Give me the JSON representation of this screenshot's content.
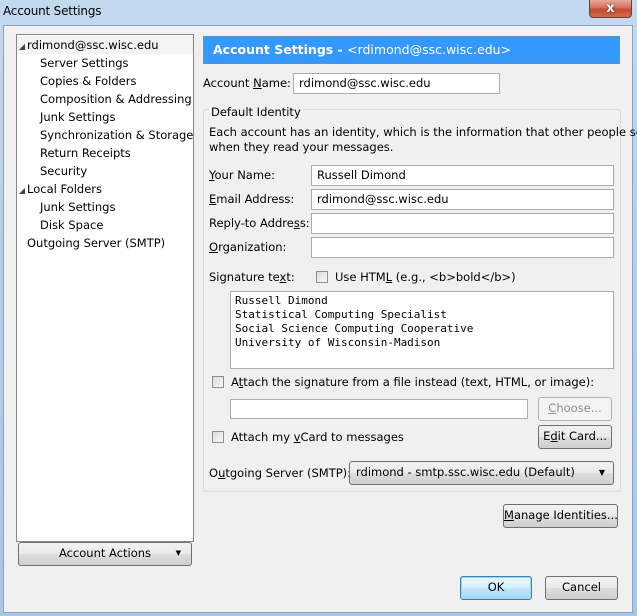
{
  "window": {
    "title": "Account Settings",
    "close_label": "x"
  },
  "tree": {
    "items": [
      {
        "label": "rdimond@ssc.wisc.edu",
        "level": 0,
        "expanded": true,
        "selected": true
      },
      {
        "label": "Server Settings",
        "level": 1
      },
      {
        "label": "Copies & Folders",
        "level": 1
      },
      {
        "label": "Composition & Addressing",
        "level": 1
      },
      {
        "label": "Junk Settings",
        "level": 1
      },
      {
        "label": "Synchronization & Storage",
        "level": 1
      },
      {
        "label": "Return Receipts",
        "level": 1
      },
      {
        "label": "Security",
        "level": 1
      },
      {
        "label": "Local Folders",
        "level": 0,
        "expanded": true
      },
      {
        "label": "Junk Settings",
        "level": 1
      },
      {
        "label": "Disk Space",
        "level": 1
      },
      {
        "label": "Outgoing Server (SMTP)",
        "level": 0
      }
    ],
    "account_actions_label": "Account Actions"
  },
  "header": {
    "title": "Account Settings - ",
    "account": "<rdimond@ssc.wisc.edu>"
  },
  "account_name": {
    "label_pre": "Account ",
    "label_u": "N",
    "label_post": "ame:",
    "value": "rdimond@ssc.wisc.edu"
  },
  "identity": {
    "legend": "Default Identity",
    "description_line1": "Each account has an identity, which is the information that other people see",
    "description_line2": "when they read your messages.",
    "your_name": {
      "label_u": "Y",
      "label_post": "our Name:",
      "value": "Russell Dimond"
    },
    "email": {
      "label_u": "E",
      "label_post": "mail Address:",
      "value": "rdimond@ssc.wisc.edu"
    },
    "reply_to": {
      "label_pre": "Reply-to Addre",
      "label_u": "s",
      "label_post": "s:",
      "value": ""
    },
    "organization": {
      "label_u": "O",
      "label_post": "rganization:",
      "value": ""
    },
    "signature": {
      "label_pre": "Signature te",
      "label_u": "x",
      "label_post": "t:",
      "use_html_pre": "Use HTM",
      "use_html_u": "L",
      "use_html_post": " (e.g., <b>bold</b>)",
      "use_html_checked": false,
      "text": "Russell Dimond\nStatistical Computing Specialist\nSocial Science Computing Cooperative\nUniversity of Wisconsin-Madison"
    },
    "attach_file": {
      "label_pre": "A",
      "label_u": "t",
      "label_post": "tach the signature from a file instead (text, HTML, or image):",
      "checked": false,
      "path": "",
      "choose_u": "C",
      "choose_post": "hoose..."
    },
    "vcard": {
      "label_pre": "Attach my ",
      "label_u": "v",
      "label_post": "Card to messages",
      "checked": false,
      "edit_pre": "E",
      "edit_u": "d",
      "edit_post": "it Card..."
    },
    "smtp": {
      "label_pre": "O",
      "label_u": "u",
      "label_post": "tgoing Server (SMTP):",
      "value": "rdimond - smtp.ssc.wisc.edu (Default)"
    }
  },
  "buttons": {
    "manage_u": "M",
    "manage_post": "anage Identities...",
    "ok": "OK",
    "cancel": "Cancel"
  }
}
